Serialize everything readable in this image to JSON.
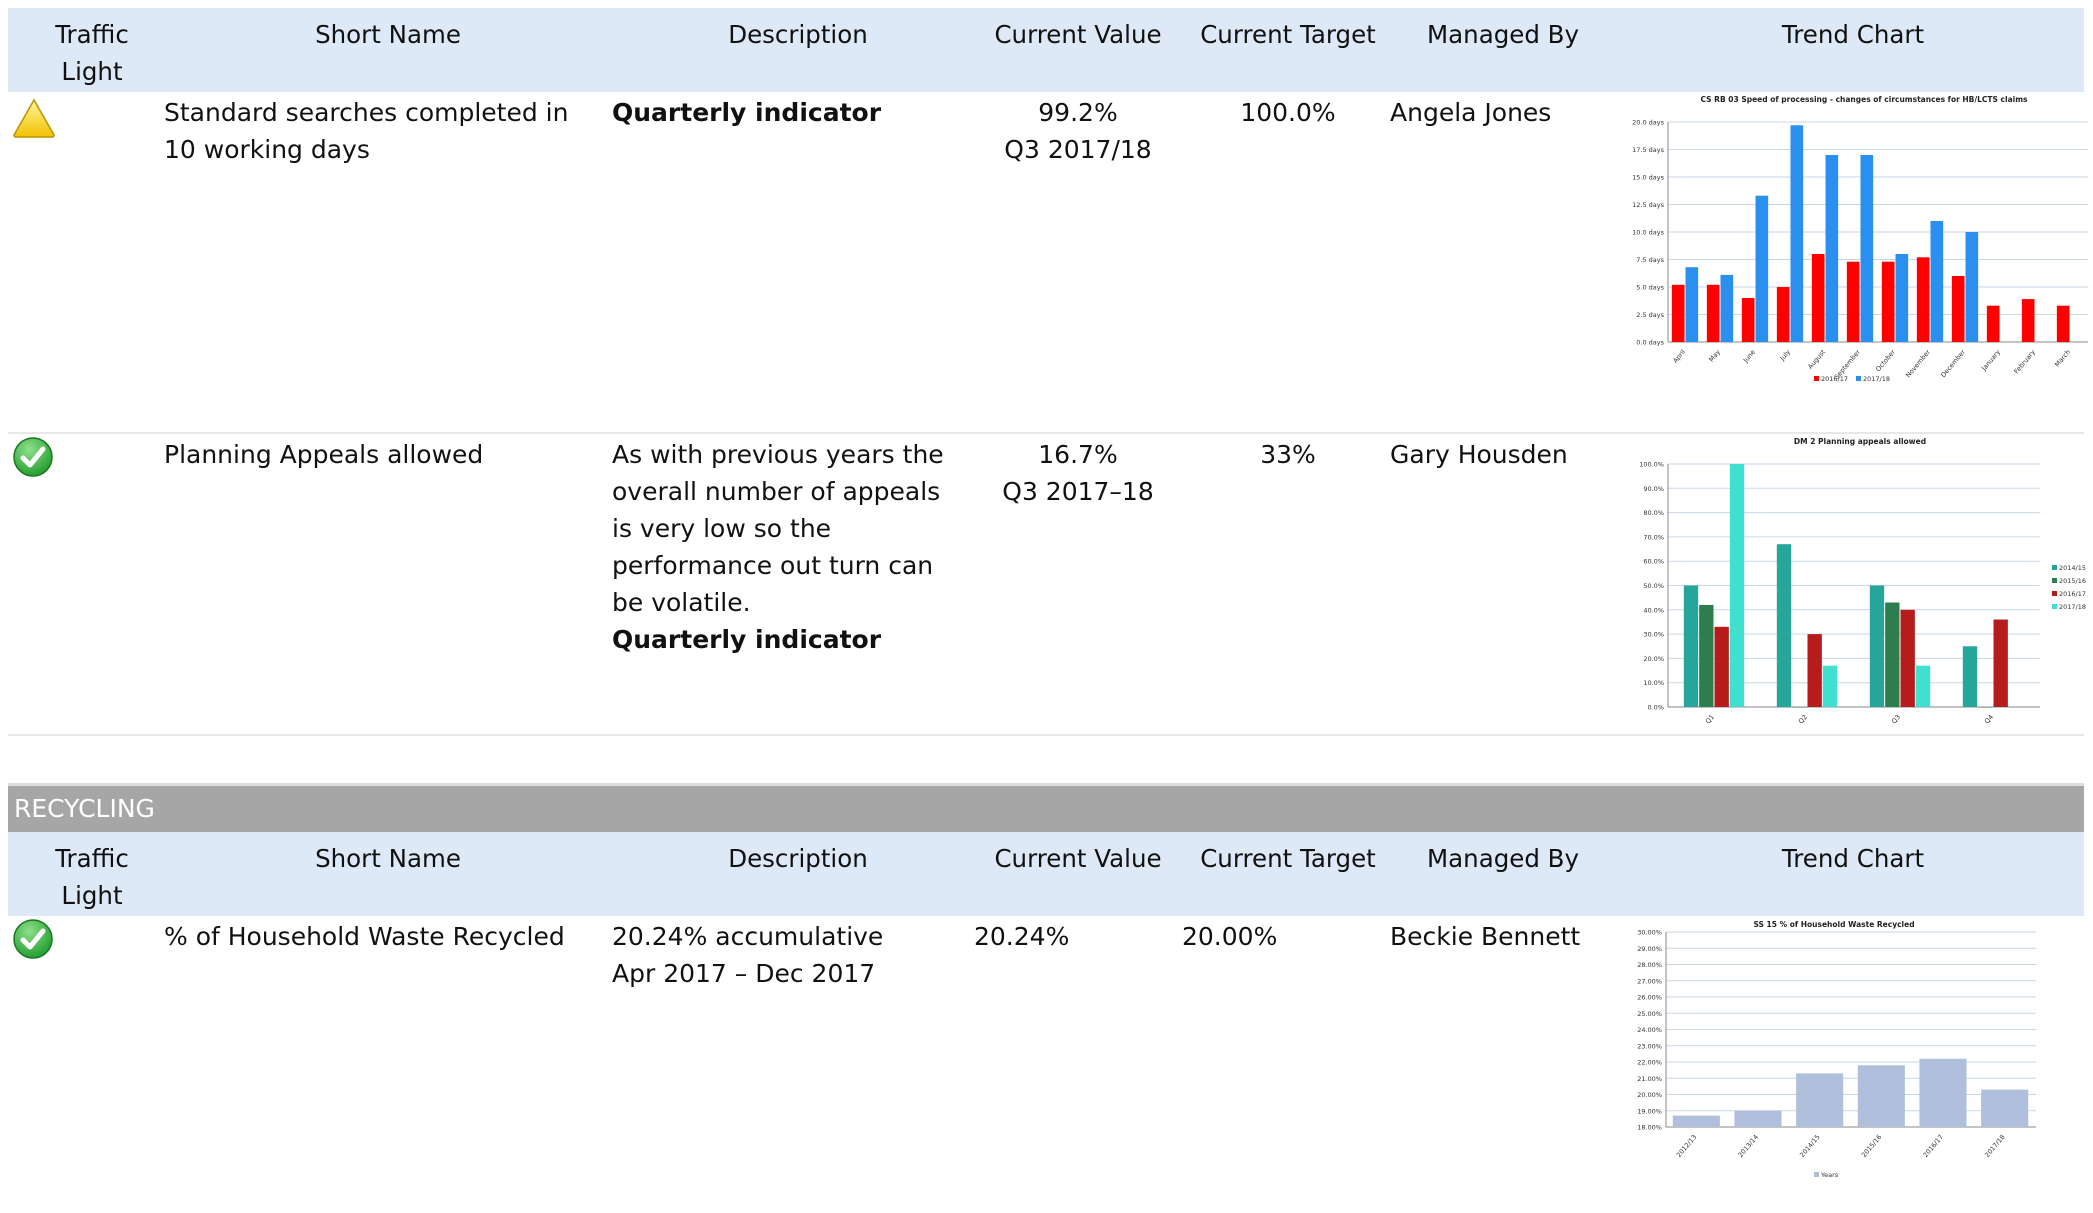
{
  "headers": {
    "traffic_light": "Traffic Light",
    "short_name": "Short Name",
    "description": "Description",
    "current_value": "Current Value",
    "current_target": "Current Target",
    "managed_by": "Managed By",
    "trend_chart": "Trend Chart"
  },
  "rows": [
    {
      "status_icon": "warning-triangle-icon",
      "short_name": "Standard searches completed in 10 working days",
      "description_bold": "Quarterly indicator",
      "value": "99.2%",
      "value_period": "Q3 2017/18",
      "target": "100.0%",
      "managed_by": "Angela Jones"
    },
    {
      "status_icon": "green-check-icon",
      "short_name": "Planning Appeals allowed",
      "description": "As with previous years the overall number of appeals is very low so the performance out turn can be volatile.",
      "description_bold": "Quarterly indicator",
      "value": "16.7%",
      "value_period": "Q3 2017–18",
      "target": "33%",
      "managed_by": "Gary Housden"
    }
  ],
  "section": {
    "title": "RECYCLING",
    "headers": {
      "traffic_light": "Traffic Light",
      "short_name": "Short Name",
      "description": "Description",
      "current_value": "Current Value",
      "current_target": "Current Target",
      "managed_by": "Managed By",
      "trend_chart": "Trend Chart"
    },
    "rows": [
      {
        "status_icon": "green-check-icon",
        "short_name": "% of Household Waste Recycled",
        "description_line1": "20.24% accumulative",
        "description_line2": "Apr 2017 – Dec 2017",
        "value": "20.24%",
        "target": "20.00%",
        "managed_by": "Beckie Bennett"
      }
    ]
  },
  "chart_data": [
    {
      "type": "bar",
      "title": "CS RB 03 Speed of processing - changes of circumstances for HB/LCTS claims",
      "categories": [
        "April",
        "May",
        "June",
        "July",
        "August",
        "September",
        "October",
        "November",
        "December",
        "January",
        "February",
        "March"
      ],
      "series": [
        {
          "name": "2016/17",
          "color": "#ff0000",
          "values": [
            5.2,
            5.2,
            4.0,
            5.0,
            8.0,
            7.3,
            7.3,
            7.7,
            6.0,
            3.3,
            3.9,
            3.3
          ]
        },
        {
          "name": "2017/18",
          "color": "#2b8ff0",
          "values": [
            6.8,
            6.1,
            13.3,
            19.7,
            17.0,
            17.0,
            8.0,
            11.0,
            10.0,
            null,
            null,
            null
          ]
        }
      ],
      "ylim": [
        0,
        20
      ],
      "yticks": [
        "0.0 days",
        "2.5 days",
        "5.0 days",
        "7.5 days",
        "10.0 days",
        "12.5 days",
        "15.0 days",
        "17.5 days",
        "20.0 days"
      ],
      "legend_position": "bottom"
    },
    {
      "type": "bar",
      "title": "DM 2 Planning appeals allowed",
      "categories": [
        "Q1",
        "Q2",
        "Q3",
        "Q4"
      ],
      "series": [
        {
          "name": "2014/15",
          "color": "#26a69a",
          "values": [
            50,
            67,
            50,
            25
          ]
        },
        {
          "name": "2015/16",
          "color": "#2e7d4f",
          "values": [
            42,
            0,
            43,
            0
          ]
        },
        {
          "name": "2016/17",
          "color": "#b71c1c",
          "values": [
            33,
            30,
            40,
            36
          ]
        },
        {
          "name": "2017/18",
          "color": "#40e0d0",
          "values": [
            100,
            17,
            17,
            null
          ]
        }
      ],
      "ylim": [
        0,
        100
      ],
      "yticks": [
        "0.0%",
        "10.0%",
        "20.0%",
        "30.0%",
        "40.0%",
        "50.0%",
        "60.0%",
        "70.0%",
        "80.0%",
        "90.0%",
        "100.0%"
      ],
      "legend_position": "right"
    },
    {
      "type": "bar",
      "title": "SS 15 % of Household Waste Recycled",
      "categories": [
        "2012/13",
        "2013/14",
        "2014/15",
        "2015/16",
        "2016/17",
        "2017/18"
      ],
      "series": [
        {
          "name": "Years",
          "color": "#b0c0dc",
          "values": [
            18.7,
            19.0,
            21.3,
            21.8,
            22.2,
            20.3
          ]
        }
      ],
      "ylim": [
        18,
        30
      ],
      "yticks": [
        "18.00%",
        "19.00%",
        "20.00%",
        "21.00%",
        "22.00%",
        "23.00%",
        "24.00%",
        "25.00%",
        "26.00%",
        "27.00%",
        "28.00%",
        "29.00%",
        "30.00%"
      ],
      "legend_position": "bottom"
    }
  ]
}
